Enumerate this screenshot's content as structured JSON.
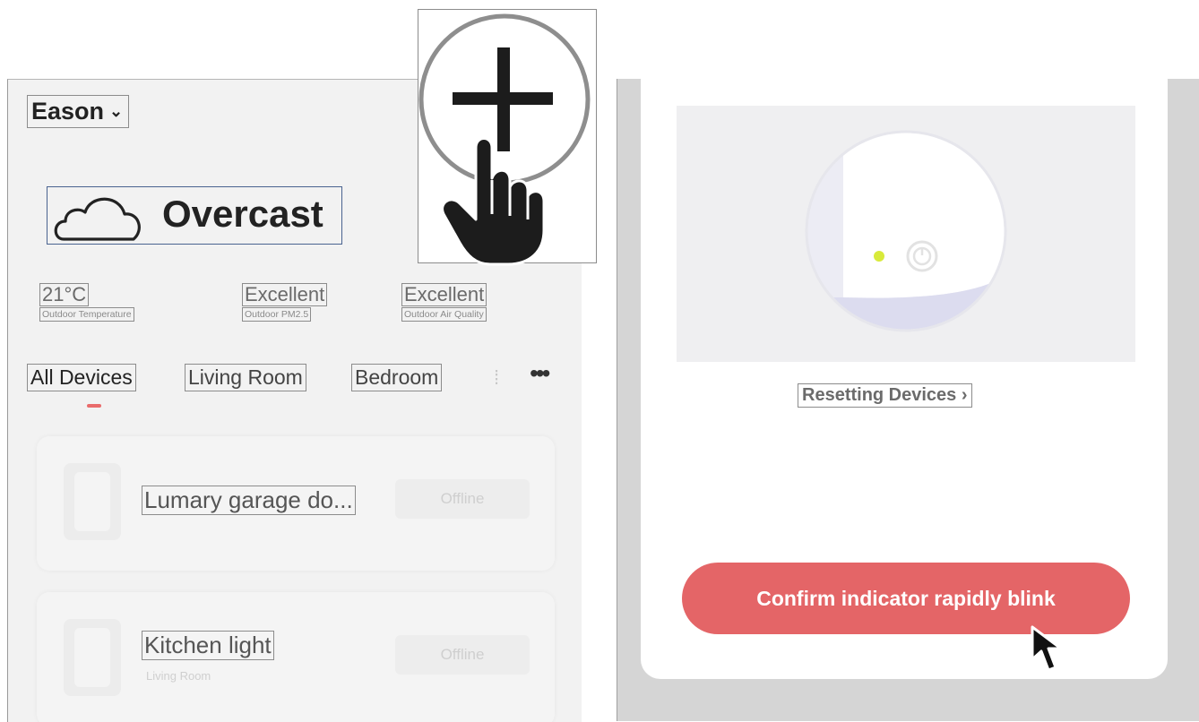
{
  "home": {
    "name": "Eason",
    "chevron": "⌄"
  },
  "weather": {
    "condition": "Overcast",
    "icon": "cloud-icon"
  },
  "stats": [
    {
      "value": "21°C",
      "label": "Outdoor Temperature"
    },
    {
      "value": "Excellent",
      "label": "Outdoor PM2.5"
    },
    {
      "value": "Excellent",
      "label": "Outdoor Air Quality"
    }
  ],
  "tabs": [
    "All Devices",
    "Living Room",
    "Bedroom"
  ],
  "more_label": "•••",
  "devices": [
    {
      "name": "Lumary garage do...",
      "room": "",
      "status": "Offline"
    },
    {
      "name": "Kitchen light",
      "room": "Living Room",
      "status": "Offline"
    }
  ],
  "reset": {
    "link_text": "Resetting Devices",
    "arrow": "›"
  },
  "confirm": {
    "label": "Confirm indicator rapidly blink"
  },
  "colors": {
    "accent": "#e46567",
    "indicator_led": "#d8ea3a",
    "tab_indicator": "#e96b6b"
  },
  "icons": [
    "cloud-icon",
    "plus-icon",
    "hand-pointer-icon",
    "power-icon",
    "cursor-arrow-icon",
    "more-icon"
  ]
}
